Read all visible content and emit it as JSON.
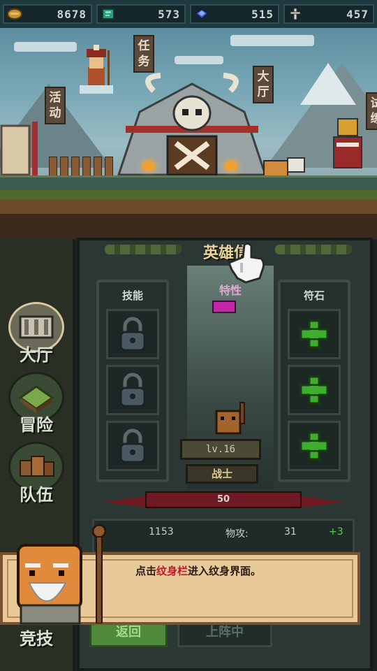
{
  "resources": [
    {
      "icon": "gold-coin-icon",
      "value": "8678"
    },
    {
      "icon": "green-gem-icon",
      "value": "573"
    },
    {
      "icon": "blue-diamond-icon",
      "value": "515"
    },
    {
      "icon": "sword-icon",
      "value": "457"
    }
  ],
  "village": {
    "signs": {
      "quest": "任务",
      "activity": "活动",
      "hall": "大厅",
      "right": "试练"
    }
  },
  "nav": {
    "hall": "大厅",
    "adventure": "冒险",
    "team": "队伍",
    "arena": "竞技"
  },
  "panel": {
    "title": "英雄信",
    "skills_header": "技能",
    "trait_header": "特性",
    "runes_header": "符石",
    "level": "lv.16",
    "class_name": "战士",
    "hp_value": "50",
    "stats": {
      "hp_value": "1153",
      "atk_label": "物攻:",
      "atk_value": "31",
      "atk_bonus": "+3"
    },
    "back_button": "返回",
    "unequip_button": "上阵中"
  },
  "dialog": {
    "prefix": "点击",
    "highlight": "纹身栏",
    "suffix": "进入纹身界面。"
  },
  "colors": {
    "highlight": "#c2182a",
    "trait_gem": "#c424a8",
    "rune_plus": "#3fae2e"
  }
}
